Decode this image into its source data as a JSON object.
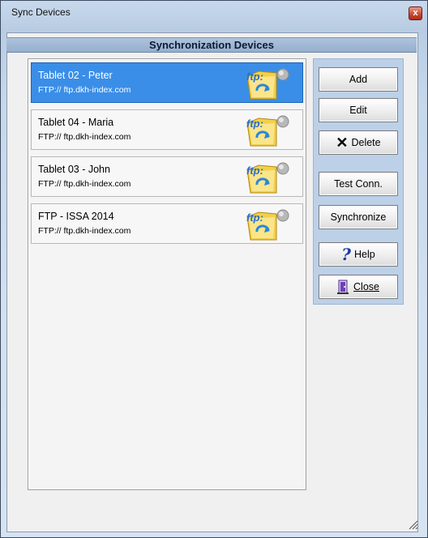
{
  "window": {
    "title": "Sync Devices",
    "close_label": "x"
  },
  "header": {
    "title": "Synchronization Devices"
  },
  "devices": [
    {
      "name": "Tablet 02 - Peter",
      "url": "FTP:// ftp.dkh-index.com",
      "selected": true,
      "icon": "ftp-folder-sync-icon"
    },
    {
      "name": "Tablet 04 - Maria",
      "url": "FTP:// ftp.dkh-index.com",
      "selected": false,
      "icon": "ftp-folder-sync-icon"
    },
    {
      "name": "Tablet 03 - John",
      "url": "FTP:// ftp.dkh-index.com",
      "selected": false,
      "icon": "ftp-folder-sync-icon"
    },
    {
      "name": "FTP - ISSA 2014",
      "url": "FTP:// ftp.dkh-index.com",
      "selected": false,
      "icon": "ftp-folder-sync-icon"
    }
  ],
  "buttons": {
    "add": "Add",
    "edit": "Edit",
    "delete": "Delete",
    "test": "Test Conn.",
    "sync": "Synchronize",
    "help": "Help",
    "close": "Close"
  },
  "colors": {
    "selection": "#3a8ee8",
    "header": "#95afce",
    "button_panel": "#bcd0e8"
  }
}
